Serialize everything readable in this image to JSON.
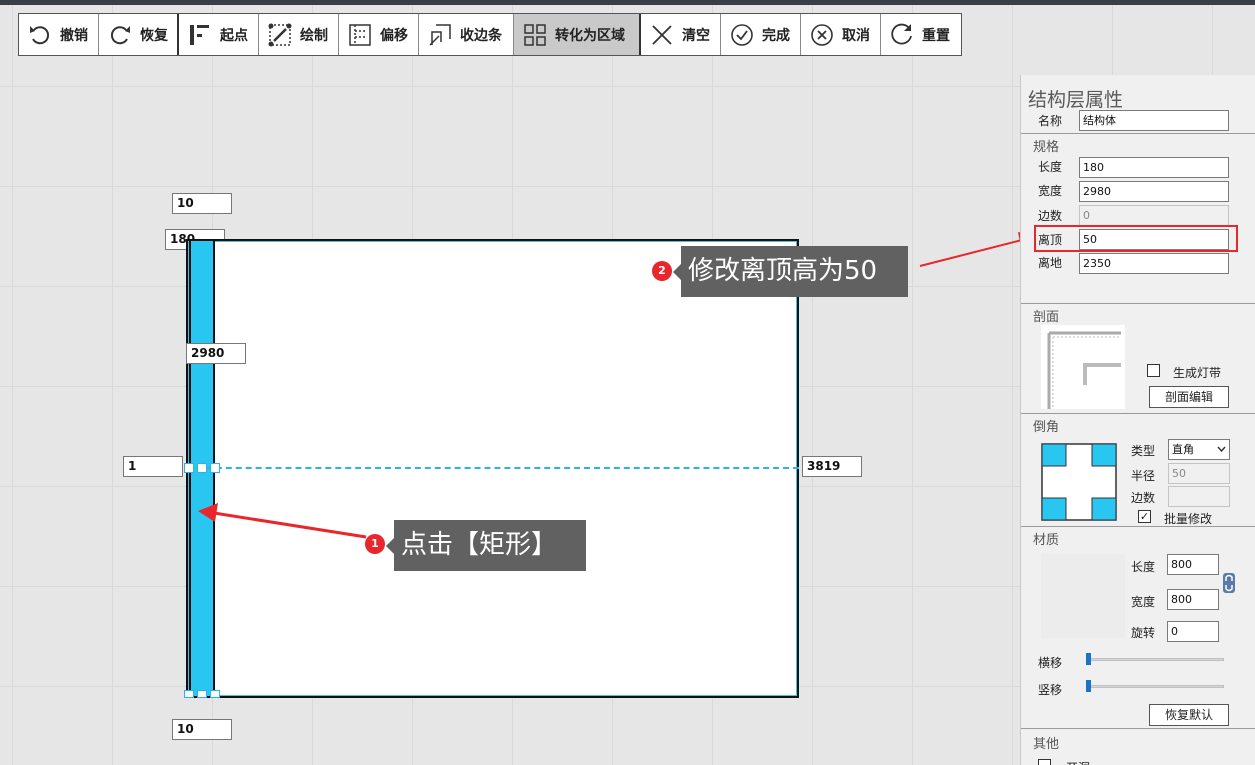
{
  "toolbar": {
    "undo": "撤销",
    "redo": "恢复",
    "start_point": "起点",
    "draw": "绘制",
    "offset": "偏移",
    "trim_edge": "收边条",
    "to_region": "转化为区域",
    "clear": "清空",
    "done": "完成",
    "cancel": "取消",
    "reset": "重置"
  },
  "canvas": {
    "dim_top_offset": "10",
    "dim_width": "180",
    "dim_length": "2980",
    "dim_left": "1",
    "dim_right": "3819",
    "dim_bottom": "10"
  },
  "callouts": {
    "step1_num": "1",
    "step1_text": "点击【矩形】",
    "step2_num": "2",
    "step2_text": "修改离顶高为50",
    "color": "#e8262c"
  },
  "panel": {
    "title": "结构层属性",
    "name_label": "名称",
    "name_value": "结构体",
    "spec": {
      "title": "规格",
      "length_label": "长度",
      "length_value": "180",
      "width_label": "宽度",
      "width_value": "2980",
      "sides_label": "边数",
      "sides_value": "0",
      "top_gap_label": "离顶",
      "top_gap_value": "50",
      "floor_gap_label": "离地",
      "floor_gap_value": "2350"
    },
    "profile": {
      "title": "剖面",
      "light_strip_label": "生成灯带",
      "light_strip_checked": false,
      "edit_button": "剖面编辑"
    },
    "chamfer": {
      "title": "倒角",
      "type_label": "类型",
      "type_value": "直角",
      "radius_label": "半径",
      "radius_value": "50",
      "sides_label": "边数",
      "sides_value": "",
      "batch_label": "批量修改",
      "batch_checked": true,
      "accent": "#29c6f2"
    },
    "material": {
      "title": "材质",
      "length_label": "长度",
      "length_value": "800",
      "width_label": "宽度",
      "width_value": "800",
      "rotate_label": "旋转",
      "rotate_value": "0",
      "hshift_label": "横移",
      "vshift_label": "竖移",
      "reset_button": "恢复默认"
    },
    "other": {
      "title": "其他",
      "open_label": "开洞"
    }
  }
}
